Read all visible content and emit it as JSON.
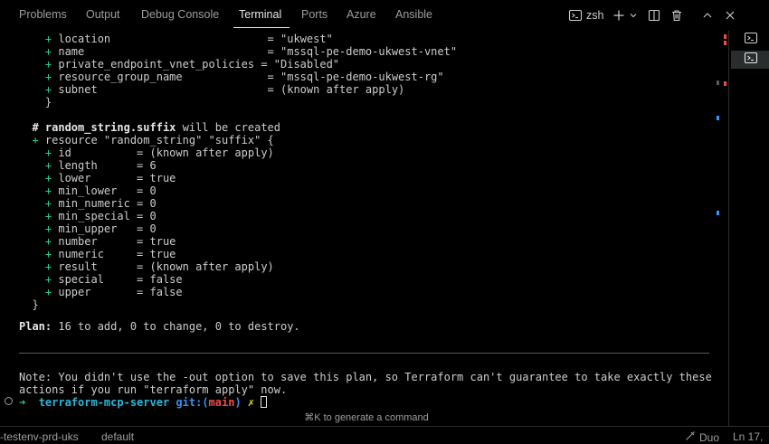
{
  "panel": {
    "tabs": [
      {
        "label": "Problems"
      },
      {
        "label": "Output"
      },
      {
        "label": "Debug Console"
      },
      {
        "label": "Terminal"
      },
      {
        "label": "Ports"
      },
      {
        "label": "Azure"
      },
      {
        "label": "Ansible"
      }
    ],
    "active_tab": "Terminal",
    "shell_label": "zsh"
  },
  "terminal": {
    "lines": [
      {
        "indent": "    ",
        "prefix": "+ ",
        "text": "location                        = \"ukwest\""
      },
      {
        "indent": "    ",
        "prefix": "+ ",
        "text": "name                            = \"mssql-pe-demo-ukwest-vnet\""
      },
      {
        "indent": "    ",
        "prefix": "+ ",
        "text": "private_endpoint_vnet_policies = \"Disabled\""
      },
      {
        "indent": "    ",
        "prefix": "+ ",
        "text": "resource_group_name             = \"mssql-pe-demo-ukwest-rg\""
      },
      {
        "indent": "    ",
        "prefix": "+ ",
        "text": "subnet                          = (known after apply)"
      },
      {
        "indent": "    ",
        "prefix": "",
        "text": "}"
      },
      {
        "indent": "",
        "prefix": "",
        "text": ""
      },
      {
        "indent": "  ",
        "prefix": "",
        "comment_hash": "# ",
        "comment_bold": "random_string.suffix",
        "comment_rest": " will be created"
      },
      {
        "indent": "  ",
        "prefix": "+ ",
        "text": "resource \"random_string\" \"suffix\" {"
      },
      {
        "indent": "    ",
        "prefix": "+ ",
        "text": "id          = (known after apply)"
      },
      {
        "indent": "    ",
        "prefix": "+ ",
        "text": "length      = 6"
      },
      {
        "indent": "    ",
        "prefix": "+ ",
        "text": "lower       = true"
      },
      {
        "indent": "    ",
        "prefix": "+ ",
        "text": "min_lower   = 0"
      },
      {
        "indent": "    ",
        "prefix": "+ ",
        "text": "min_numeric = 0"
      },
      {
        "indent": "    ",
        "prefix": "+ ",
        "text": "min_special = 0"
      },
      {
        "indent": "    ",
        "prefix": "+ ",
        "text": "min_upper   = 0"
      },
      {
        "indent": "    ",
        "prefix": "+ ",
        "text": "number      = true"
      },
      {
        "indent": "    ",
        "prefix": "+ ",
        "text": "numeric     = true"
      },
      {
        "indent": "    ",
        "prefix": "+ ",
        "text": "result      = (known after apply)"
      },
      {
        "indent": "    ",
        "prefix": "+ ",
        "text": "special     = false"
      },
      {
        "indent": "    ",
        "prefix": "+ ",
        "text": "upper       = false"
      },
      {
        "indent": "  ",
        "prefix": "",
        "text": "}"
      }
    ],
    "plan_label": "Plan:",
    "plan_text": " 16 to add, 0 to change, 0 to destroy.",
    "note_line1": "Note: You didn't use the -out option to save this plan, so Terraform can't guarantee to take exactly these",
    "note_line2": "actions if you run \"terraform apply\" now.",
    "prompt_arrow": "➜",
    "prompt_dir": "terraform-mcp-server",
    "prompt_git": "git:(",
    "prompt_branch": "main",
    "prompt_git_close": ")",
    "prompt_dirty": "✗",
    "hint": "⌘K to generate a command"
  },
  "statusbar": {
    "left1": "-testenv-prd-uks",
    "left2": "default",
    "duo": "Duo",
    "position": "Ln 17,"
  },
  "colors": {
    "added": "#23d18b",
    "path": "#29b8db",
    "branch": "#f14c4c",
    "git": "#3b8eea",
    "marker_red": "#f14c4c",
    "marker_blue": "#3794ff"
  },
  "icons": [
    "terminal-icon",
    "plus-icon",
    "chevron-down-icon",
    "split-icon",
    "trash-icon",
    "chevron-up-icon",
    "close-icon",
    "duo-icon"
  ]
}
